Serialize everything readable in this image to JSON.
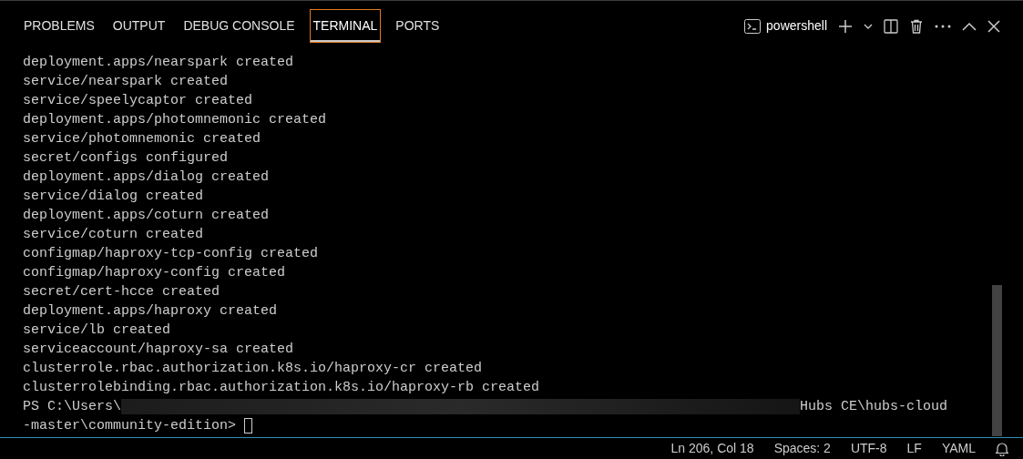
{
  "panel_tabs": [
    {
      "label": "PROBLEMS",
      "selected": false
    },
    {
      "label": "OUTPUT",
      "selected": false
    },
    {
      "label": "DEBUG CONSOLE",
      "selected": false
    },
    {
      "label": "TERMINAL",
      "selected": true
    },
    {
      "label": "PORTS",
      "selected": false
    }
  ],
  "terminal_profile": "powershell",
  "terminal_lines": [
    "deployment.apps/nearspark created",
    "service/nearspark created",
    "service/speelycaptor created",
    "deployment.apps/photomnemonic created",
    "service/photomnemonic created",
    "secret/configs configured",
    "deployment.apps/dialog created",
    "service/dialog created",
    "deployment.apps/coturn created",
    "service/coturn created",
    "configmap/haproxy-tcp-config created",
    "configmap/haproxy-config created",
    "secret/cert-hcce created",
    "deployment.apps/haproxy created",
    "service/lb created",
    "serviceaccount/haproxy-sa created",
    "clusterrole.rbac.authorization.k8s.io/haproxy-cr created",
    "clusterrolebinding.rbac.authorization.k8s.io/haproxy-rb created"
  ],
  "prompt": {
    "before_redaction": "PS C:\\Users\\",
    "after_redaction": "Hubs CE\\hubs-cloud",
    "continuation": "-master\\community-edition>"
  },
  "status_bar": [
    "Ln 206, Col 18",
    "Spaces: 2",
    "UTF-8",
    "LF",
    "YAML"
  ]
}
